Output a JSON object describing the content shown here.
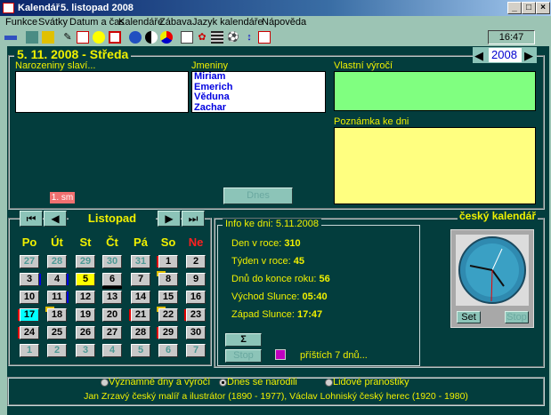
{
  "window": {
    "app": "Kalendář",
    "date_title": "5. listopad 2008",
    "min": "_",
    "max": "□",
    "close": "×"
  },
  "menu": [
    "Funkce",
    "Svátky",
    "Datum a čas",
    "Kalendáře",
    "Zábava",
    "Jazyk kalendáře",
    "Nápověda"
  ],
  "toolbar": {
    "icons": [
      "flag-icon",
      "square-icon",
      "calendar-grid-icon",
      "notepad-icon",
      "calendar-icon",
      "smiley-icon",
      "clock-icon",
      "globe-icon",
      "moon-icon",
      "pie-icon",
      "document-icon",
      "flower-icon",
      "list-icon",
      "ball-icon",
      "thermometer-icon",
      "note-icon"
    ],
    "time": "16:47"
  },
  "header": {
    "date": "5. 11. 2008  - Středa",
    "year": "2008"
  },
  "birthdays": {
    "label": "Narozeniny slaví..."
  },
  "namedays": {
    "label": "Jmeniny",
    "names": [
      "Miriam",
      "Emerich",
      "Věduna",
      "Zachar"
    ]
  },
  "anniversary": {
    "label": "Vlastní výročí"
  },
  "note": {
    "label": "Poznámka ke dni"
  },
  "tag": "1. sm",
  "today_button": "Dnes",
  "calendar": {
    "month": "Listopad",
    "weekdays": [
      "Po",
      "Út",
      "St",
      "Čt",
      "Pá",
      "So",
      "Ne"
    ],
    "weeks": [
      [
        "27",
        "28",
        "29",
        "30",
        "31",
        "1",
        "2"
      ],
      [
        "3",
        "4",
        "5",
        "6",
        "7",
        "8",
        "9"
      ],
      [
        "10",
        "11",
        "12",
        "13",
        "14",
        "15",
        "16"
      ],
      [
        "17",
        "18",
        "19",
        "20",
        "21",
        "22",
        "23"
      ],
      [
        "24",
        "25",
        "26",
        "27",
        "28",
        "29",
        "30"
      ],
      [
        "1",
        "2",
        "3",
        "4",
        "5",
        "6",
        "7"
      ]
    ]
  },
  "info": {
    "title": "Info ke dni: 5.11.2008",
    "rows": [
      {
        "label": "Den v roce:",
        "value": "310"
      },
      {
        "label": "Týden v roce:",
        "value": "45"
      },
      {
        "label": "Dnů do konce roku:",
        "value": "56"
      },
      {
        "label": "Východ Slunce:",
        "value": "05:40"
      },
      {
        "label": "Západ Slunce:",
        "value": "17:47"
      }
    ],
    "sum_button": "Σ",
    "stop_button": "Stop",
    "next_days": "příštích 7 dnů..."
  },
  "clock": {
    "title": "český kalendář",
    "set": "Set",
    "stop": "Stop"
  },
  "bottom": {
    "options": [
      "Významné dny a výročí",
      "Dnes se narodili",
      "Lidové pranostiky"
    ],
    "selected": 1,
    "text": "Jan Zrzavý český malíř a ilustrátor (1890 - 1977), Václav  Lohniský český herec (1920 - 1980)"
  },
  "colors": {
    "bg": "#033d3d",
    "text": "#f0f000",
    "today": "#ffff00",
    "selected": "#00ffff"
  }
}
